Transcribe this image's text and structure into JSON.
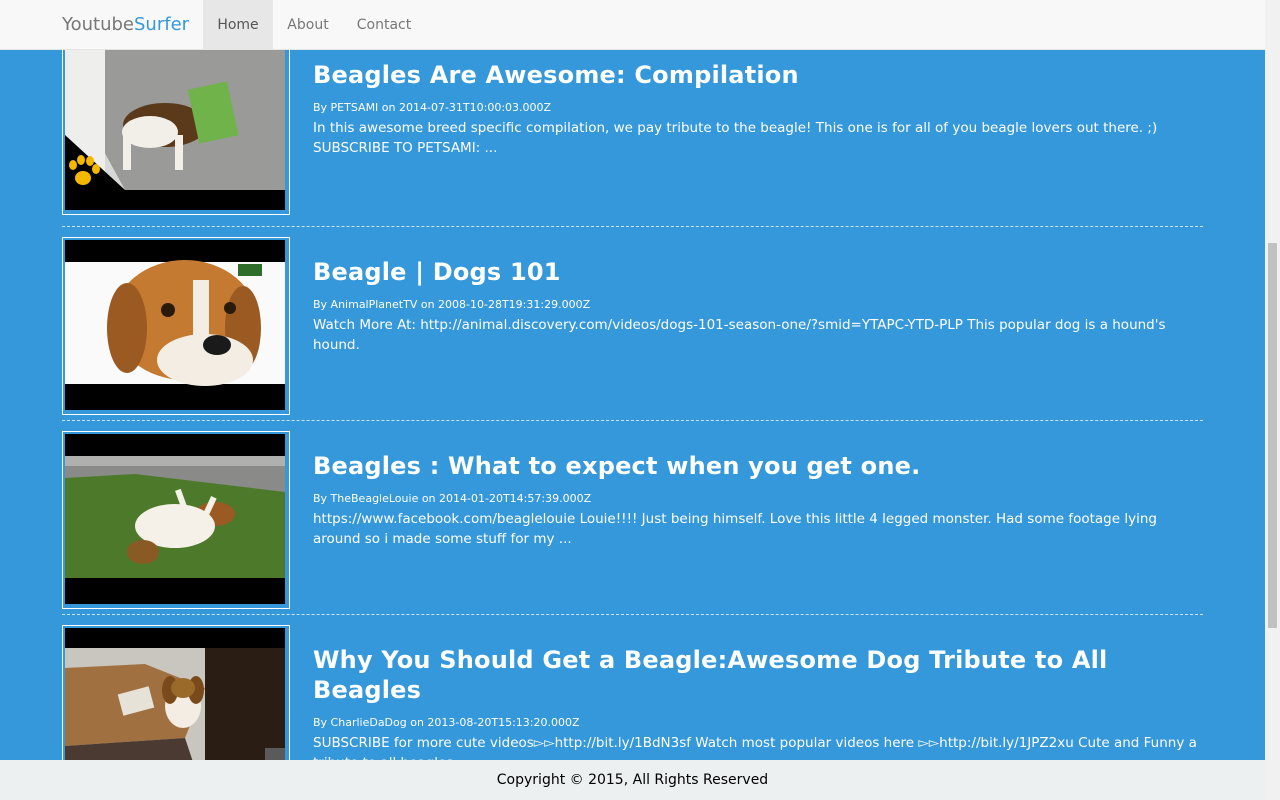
{
  "navbar": {
    "brand_main": "Youtube",
    "brand_accent": "Surfer",
    "items": [
      {
        "label": "Home",
        "active": true
      },
      {
        "label": "About",
        "active": false
      },
      {
        "label": "Contact",
        "active": false
      }
    ]
  },
  "videos": [
    {
      "title": "Beagles Are Awesome: Compilation",
      "meta": "By PETSAMI on 2014-07-31T10:00:03.000Z",
      "description": "In this awesome breed specific compilation, we pay tribute to the beagle! This one is for all of you beagle lovers out there. ;) SUBSCRIBE TO PETSAMI: ..."
    },
    {
      "title": "Beagle | Dogs 101",
      "meta": "By AnimalPlanetTV on 2008-10-28T19:31:29.000Z",
      "description": "Watch More At: http://animal.discovery.com/videos/dogs-101-season-one/?smid=YTAPC-YTD-PLP This popular dog is a hound's hound."
    },
    {
      "title": "Beagles : What to expect when you get one.",
      "meta": "By TheBeagleLouie on 2014-01-20T14:57:39.000Z",
      "description": "https://www.facebook.com/beaglelouie Louie!!!! Just being himself. Love this little 4 legged monster. Had some footage lying around so i made some stuff for my ..."
    },
    {
      "title": "Why You Should Get a Beagle:Awesome Dog Tribute to All Beagles",
      "meta": "By CharlieDaDog on 2013-08-20T15:13:20.000Z",
      "description": "SUBSCRIBE for more cute videos▻▻http://bit.ly/1BdN3sf Watch most popular videos here ▻▻http://bit.ly/1JPZ2xu Cute and Funny a tribute to all beagles ..."
    }
  ],
  "footer": {
    "copyright": "Copyright © 2015, All Rights Reserved"
  },
  "colors": {
    "background": "#3498db",
    "navbar": "#f8f8f8",
    "footer": "#ecf0f1"
  }
}
